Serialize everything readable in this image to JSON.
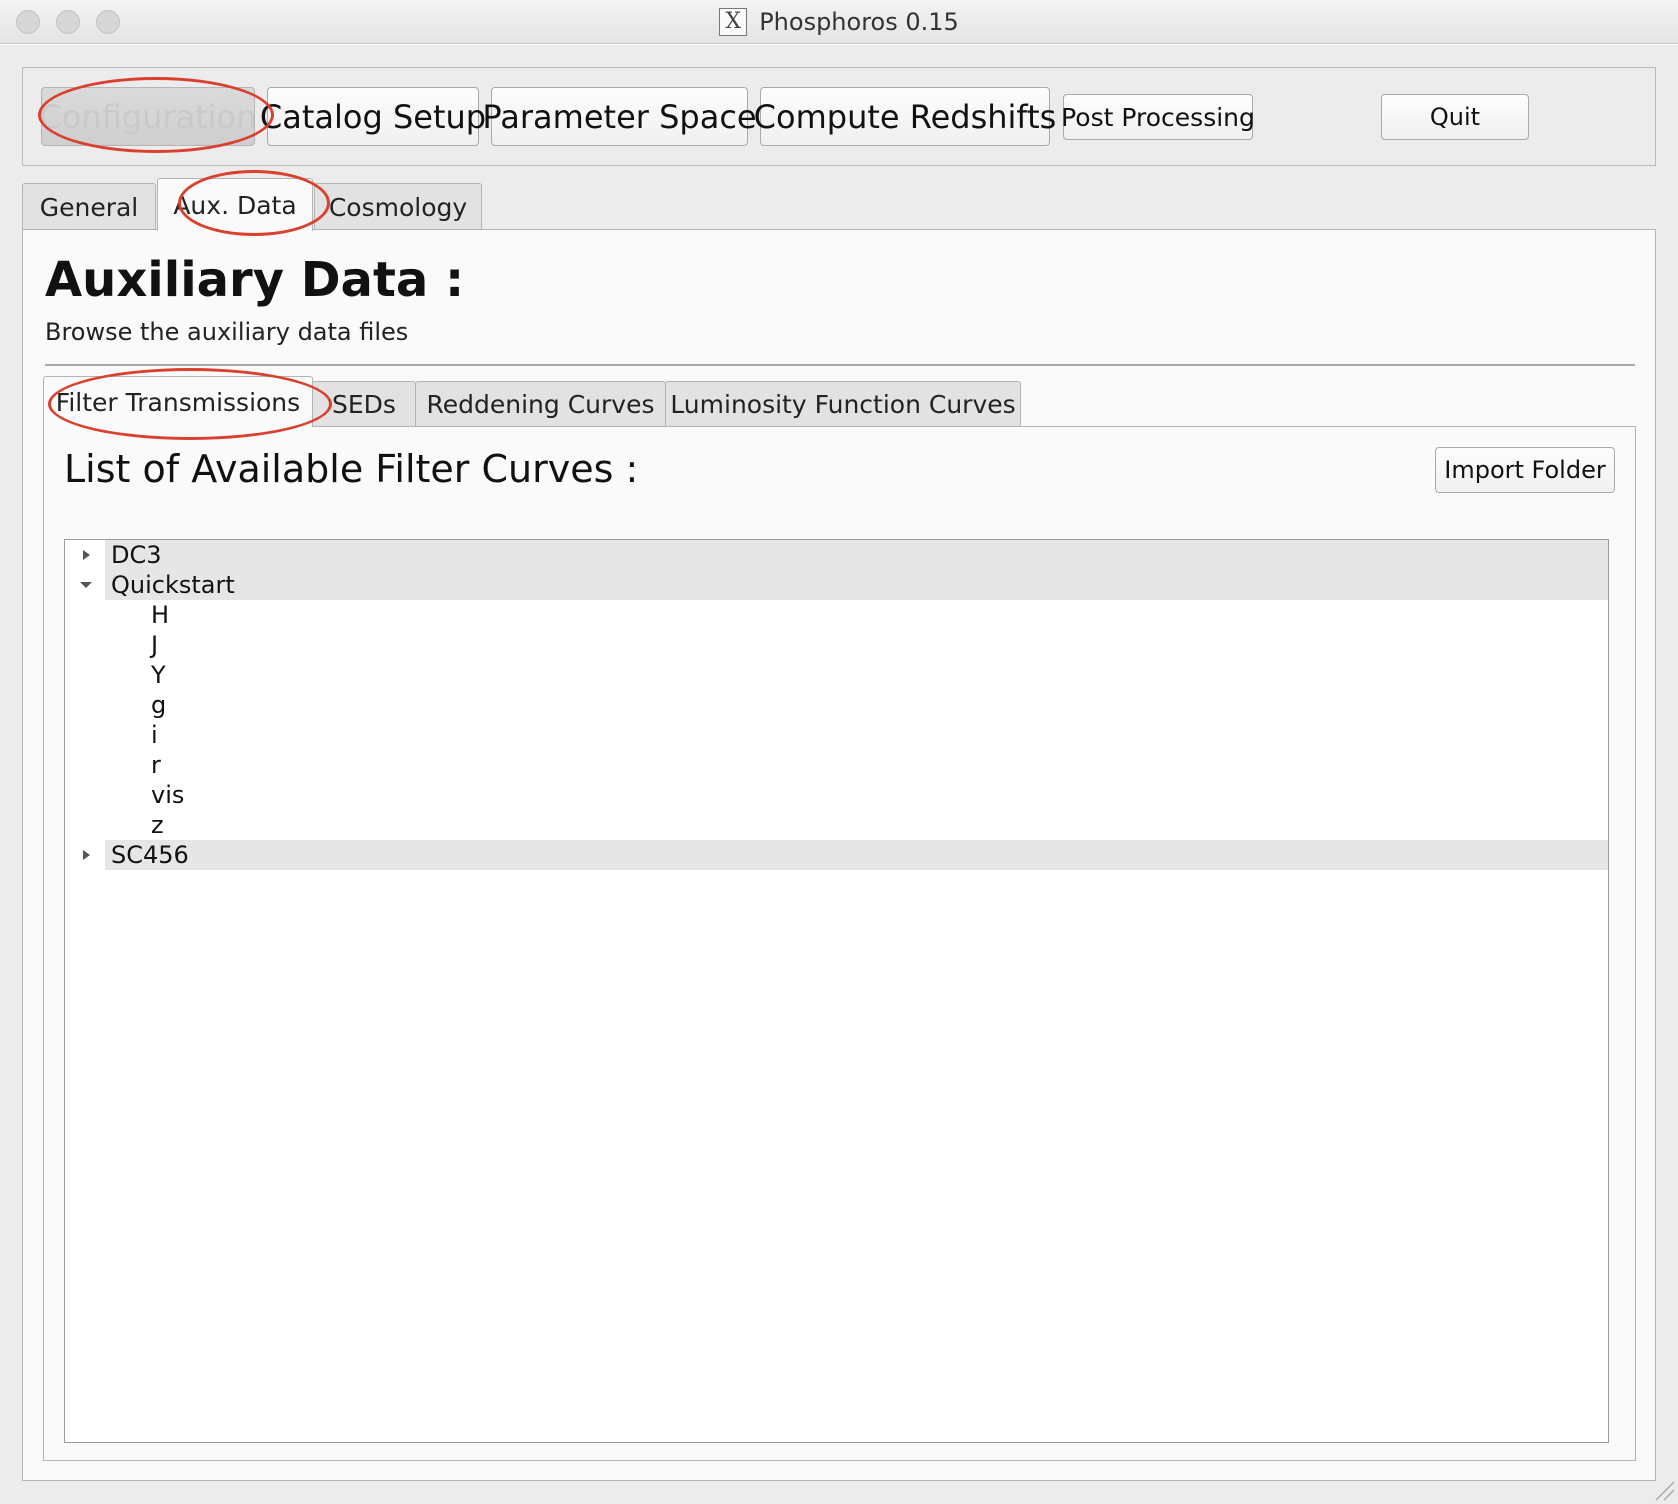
{
  "window": {
    "title": "Phosphoros 0.15",
    "app_icon": "x11-icon"
  },
  "toolbar": {
    "configuration_label": "Configuration",
    "catalog_setup_label": "Catalog Setup",
    "parameter_space_label": "Parameter Space",
    "compute_redshifts_label": "Compute Redshifts",
    "post_processing_label": "Post Processing",
    "quit_label": "Quit"
  },
  "tabs": {
    "general": "General",
    "aux_data": "Aux. Data",
    "cosmology": "Cosmology",
    "active": "Aux. Data"
  },
  "aux": {
    "title": "Auxiliary Data :",
    "subtitle": "Browse the auxiliary data files",
    "subtabs": {
      "filter_transmissions": "Filter Transmissions",
      "seds": "SEDs",
      "reddening_curves": "Reddening Curves",
      "luminosity_function_curves": "Luminosity Function Curves",
      "active": "Filter Transmissions"
    },
    "list_title": "List of Available Filter Curves  :",
    "import_folder_label": "Import Folder",
    "tree": {
      "dc3": {
        "label": "DC3",
        "expanded": false
      },
      "quickstart": {
        "label": "Quickstart",
        "expanded": true,
        "children": [
          "H",
          "J",
          "Y",
          "g",
          "i",
          "r",
          "vis",
          "z"
        ]
      },
      "sc456": {
        "label": "SC456",
        "expanded": false
      }
    }
  },
  "annotations": {
    "highlight_color": "#d9412e"
  }
}
